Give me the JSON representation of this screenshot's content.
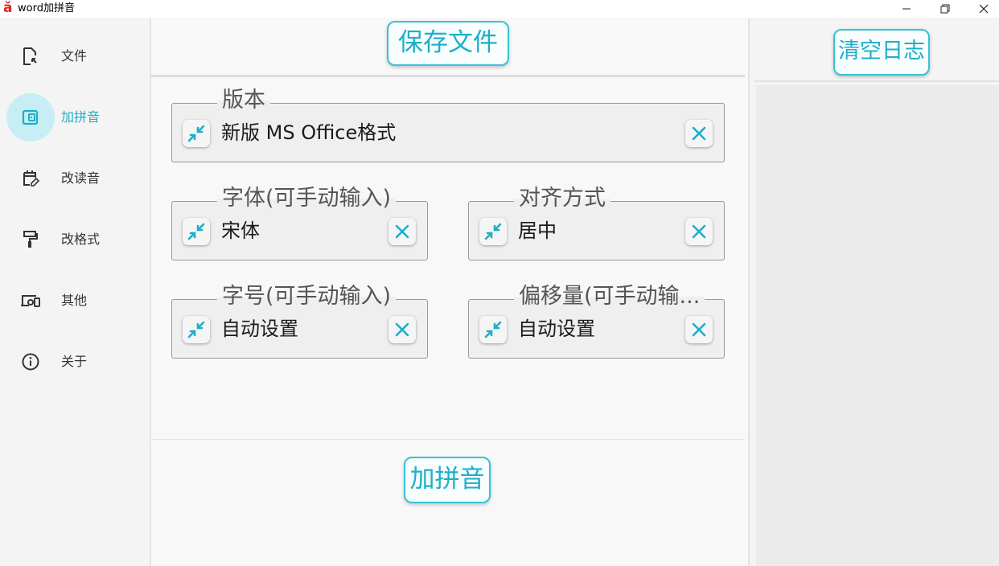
{
  "window": {
    "app_icon_glyph": "ǎ",
    "title": "word加拼音"
  },
  "sidebar": {
    "items": [
      {
        "label": "文件",
        "icon": "file-icon"
      },
      {
        "label": "加拼音",
        "icon": "wallet-icon",
        "active": true
      },
      {
        "label": "改读音",
        "icon": "calendar-edit-icon"
      },
      {
        "label": "改格式",
        "icon": "paint-roller-icon"
      },
      {
        "label": "其他",
        "icon": "devices-icon"
      },
      {
        "label": "关于",
        "icon": "info-icon"
      }
    ]
  },
  "main": {
    "save_label": "保存文件",
    "apply_label": "加拼音",
    "fields": {
      "version": {
        "legend": "版本",
        "value": "新版 MS Office格式"
      },
      "font": {
        "legend": "字体(可手动输入)",
        "value": "宋体"
      },
      "align": {
        "legend": "对齐方式",
        "value": "居中"
      },
      "size": {
        "legend": "字号(可手动输入)",
        "value": "自动设置"
      },
      "offset": {
        "legend": "偏移量(可手动输...",
        "value": "自动设置"
      }
    }
  },
  "log_panel": {
    "clear_label": "清空日志"
  },
  "colors": {
    "accent": "#1eaec8",
    "accent_light": "#c6eef4"
  }
}
